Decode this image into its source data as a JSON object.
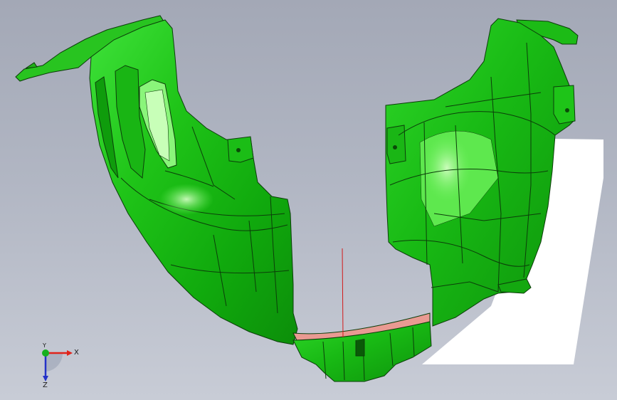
{
  "triad": {
    "x_label": "X",
    "y_label": "Y",
    "z_label": "Z",
    "colors": {
      "x": "#e0241b",
      "y": "#16b01e",
      "z": "#2432c8"
    }
  },
  "model": {
    "body_color": "#22c41a",
    "edge_color": "#0c3d0a",
    "inner_lining_color": "#e99a92",
    "center_line_color": "#d21a1a",
    "ground_plane_color": "#ffffff"
  }
}
